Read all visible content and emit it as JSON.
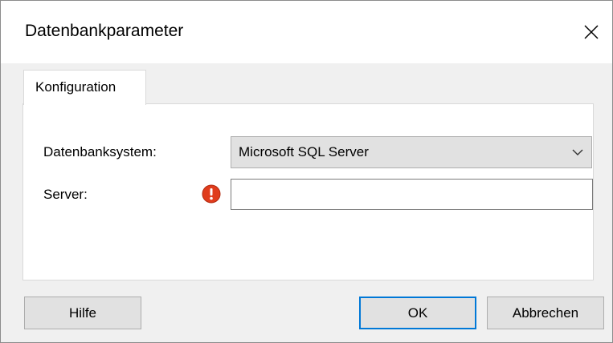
{
  "window": {
    "title": "Datenbankparameter",
    "close_icon": "close-icon"
  },
  "tabs": [
    {
      "label": "Konfiguration",
      "active": true
    }
  ],
  "form": {
    "database_system": {
      "label": "Datenbanksystem:",
      "value": "Microsoft SQL Server"
    },
    "server": {
      "label": "Server:",
      "value": "",
      "error_icon": "error-icon"
    }
  },
  "buttons": {
    "help": "Hilfe",
    "ok": "OK",
    "cancel": "Abbrechen"
  },
  "colors": {
    "accent": "#0078d7",
    "error": "#e03c1c"
  }
}
